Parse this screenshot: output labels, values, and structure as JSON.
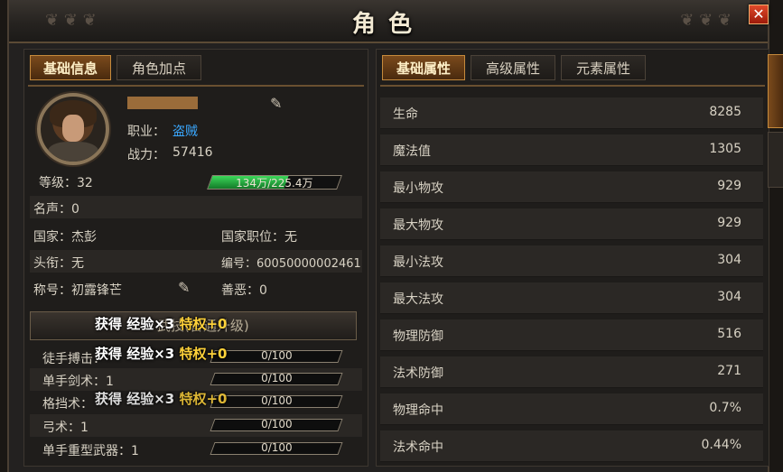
{
  "window": {
    "title": "角色",
    "close_label": "✕"
  },
  "left_tabs": [
    "基础信息",
    "角色加点"
  ],
  "profile": {
    "job_label": "职业：",
    "job_value": "盗贼",
    "power_label": "战力：",
    "power_value": "57416"
  },
  "info_rows": {
    "level": "等级：32",
    "xp": "134万/225.4万",
    "xp_fraction": 0.595,
    "fame": "名声：0",
    "country": "国家：杰彭",
    "country_position": "国家职位：无",
    "rank_title": "头衔：无",
    "id_number": "编号：60050000002461",
    "nickname": "称号：初露锋芒",
    "karma": "善恶：0"
  },
  "skills": {
    "header": "武技(普通升级)",
    "bonus_gain": "获得 经验×3",
    "bonus_privilege": "特权+0",
    "rows": [
      {
        "label": "徒手搏击：",
        "value": "0/100"
      },
      {
        "label": "单手剑术：1",
        "value": "0/100"
      },
      {
        "label": "格挡术：",
        "value": "0/100"
      },
      {
        "label": "弓术：1",
        "value": "0/100"
      },
      {
        "label": "单手重型武器：1",
        "value": "0/100"
      }
    ]
  },
  "right_tabs": [
    "基础属性",
    "高级属性",
    "元素属性"
  ],
  "attributes": [
    {
      "name": "生命",
      "value": "8285"
    },
    {
      "name": "魔法值",
      "value": "1305"
    },
    {
      "name": "最小物攻",
      "value": "929"
    },
    {
      "name": "最大物攻",
      "value": "929"
    },
    {
      "name": "最小法攻",
      "value": "304"
    },
    {
      "name": "最大法攻",
      "value": "304"
    },
    {
      "name": "物理防御",
      "value": "516"
    },
    {
      "name": "法术防御",
      "value": "271"
    },
    {
      "name": "物理命中",
      "value": "0.7%"
    },
    {
      "name": "法术命中",
      "value": "0.44%"
    }
  ],
  "icons": [
    "quill-icon",
    "close-icon",
    "avatar-portrait"
  ],
  "colors": {
    "accent": "#c58a3c",
    "job": "#3aa8ff",
    "bonus": "#ffd23a",
    "close": "#d0301a"
  }
}
